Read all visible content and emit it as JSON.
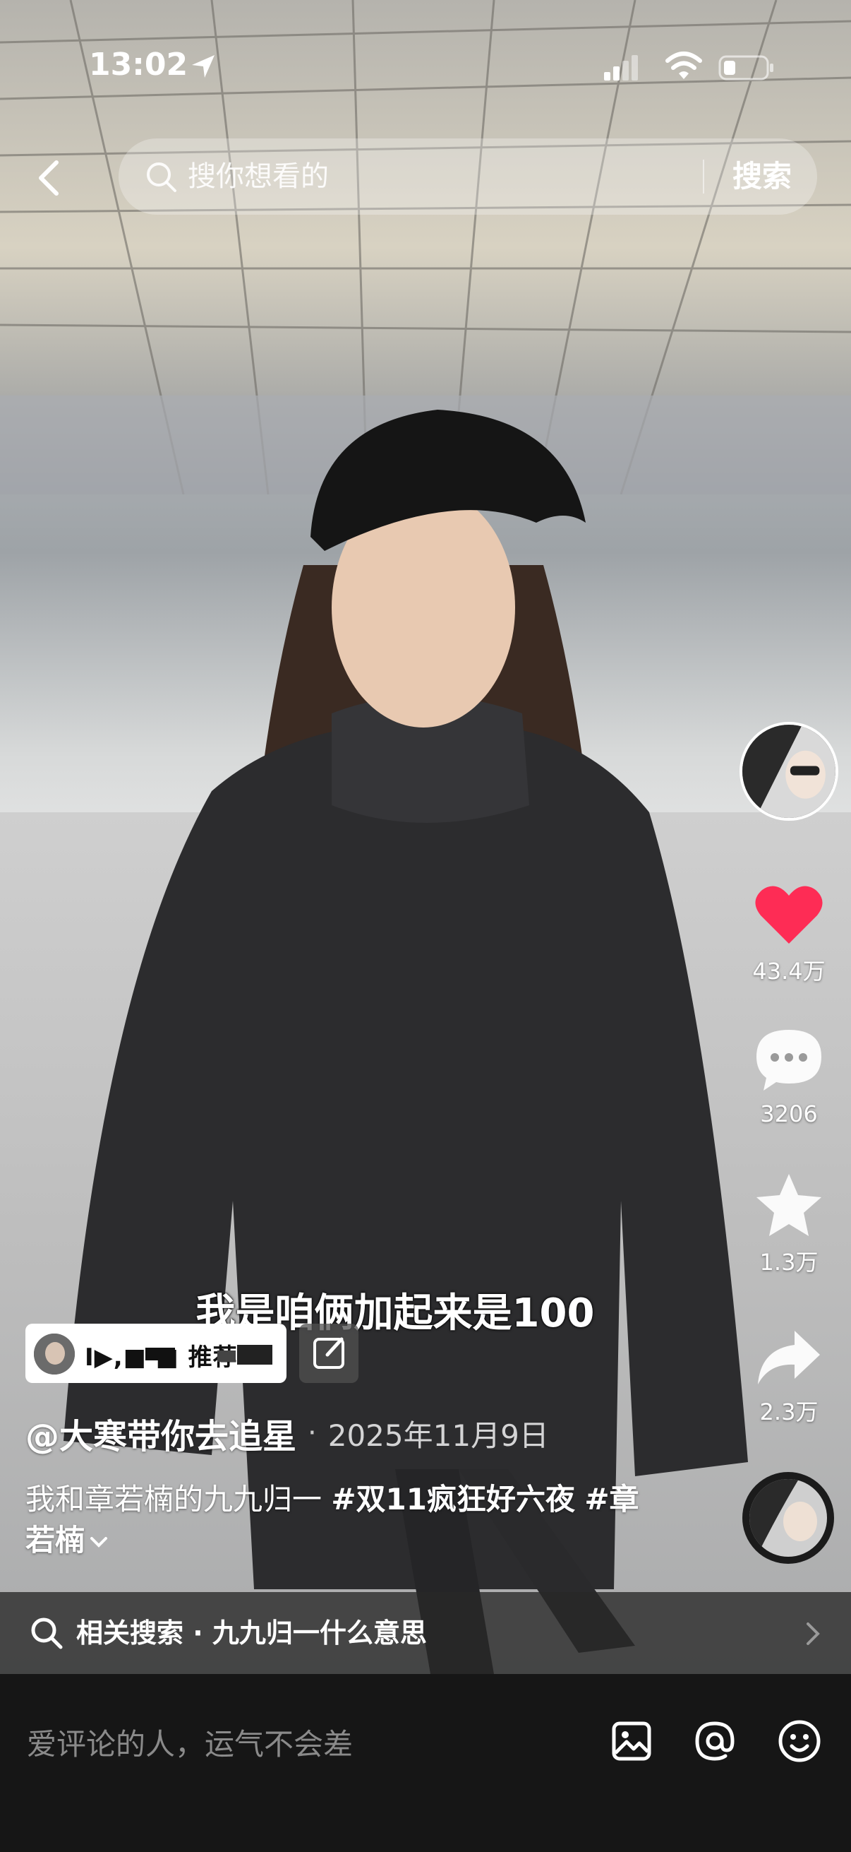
{
  "status_bar": {
    "time": "13:02"
  },
  "top_bar": {
    "search_placeholder": "搜你想看的",
    "search_button": "搜索"
  },
  "actions": {
    "likes": "43.4万",
    "comments": "3206",
    "favorites": "1.3万",
    "shares": "2.3万"
  },
  "video": {
    "subtitle": "我是咱俩加起来是100",
    "product_label": "I▶,■   ■ 推荐",
    "author": "@大寒带你去追星",
    "separator": "·",
    "date": "2025年11月9日",
    "description_text": "我和章若楠的九九归一 ",
    "hashtags": [
      "#双11疯狂好六夜",
      "#章若楠"
    ]
  },
  "related_search": {
    "label": "相关搜索",
    "separator": "·",
    "query": "九九归一什么意思"
  },
  "comment_bar": {
    "placeholder": "爱评论的人，运气不会差"
  },
  "colors": {
    "like_red": "#fe2c55",
    "bar_dark": "#161616"
  },
  "icons": [
    "back-icon",
    "search-icon",
    "heart-icon",
    "comment-icon",
    "star-icon",
    "share-icon",
    "image-icon",
    "at-icon",
    "emoji-icon",
    "edit-icon",
    "location-arrow-icon",
    "signal-icon",
    "wifi-icon",
    "battery-icon",
    "chevron-right-icon",
    "chevron-down-icon"
  ]
}
